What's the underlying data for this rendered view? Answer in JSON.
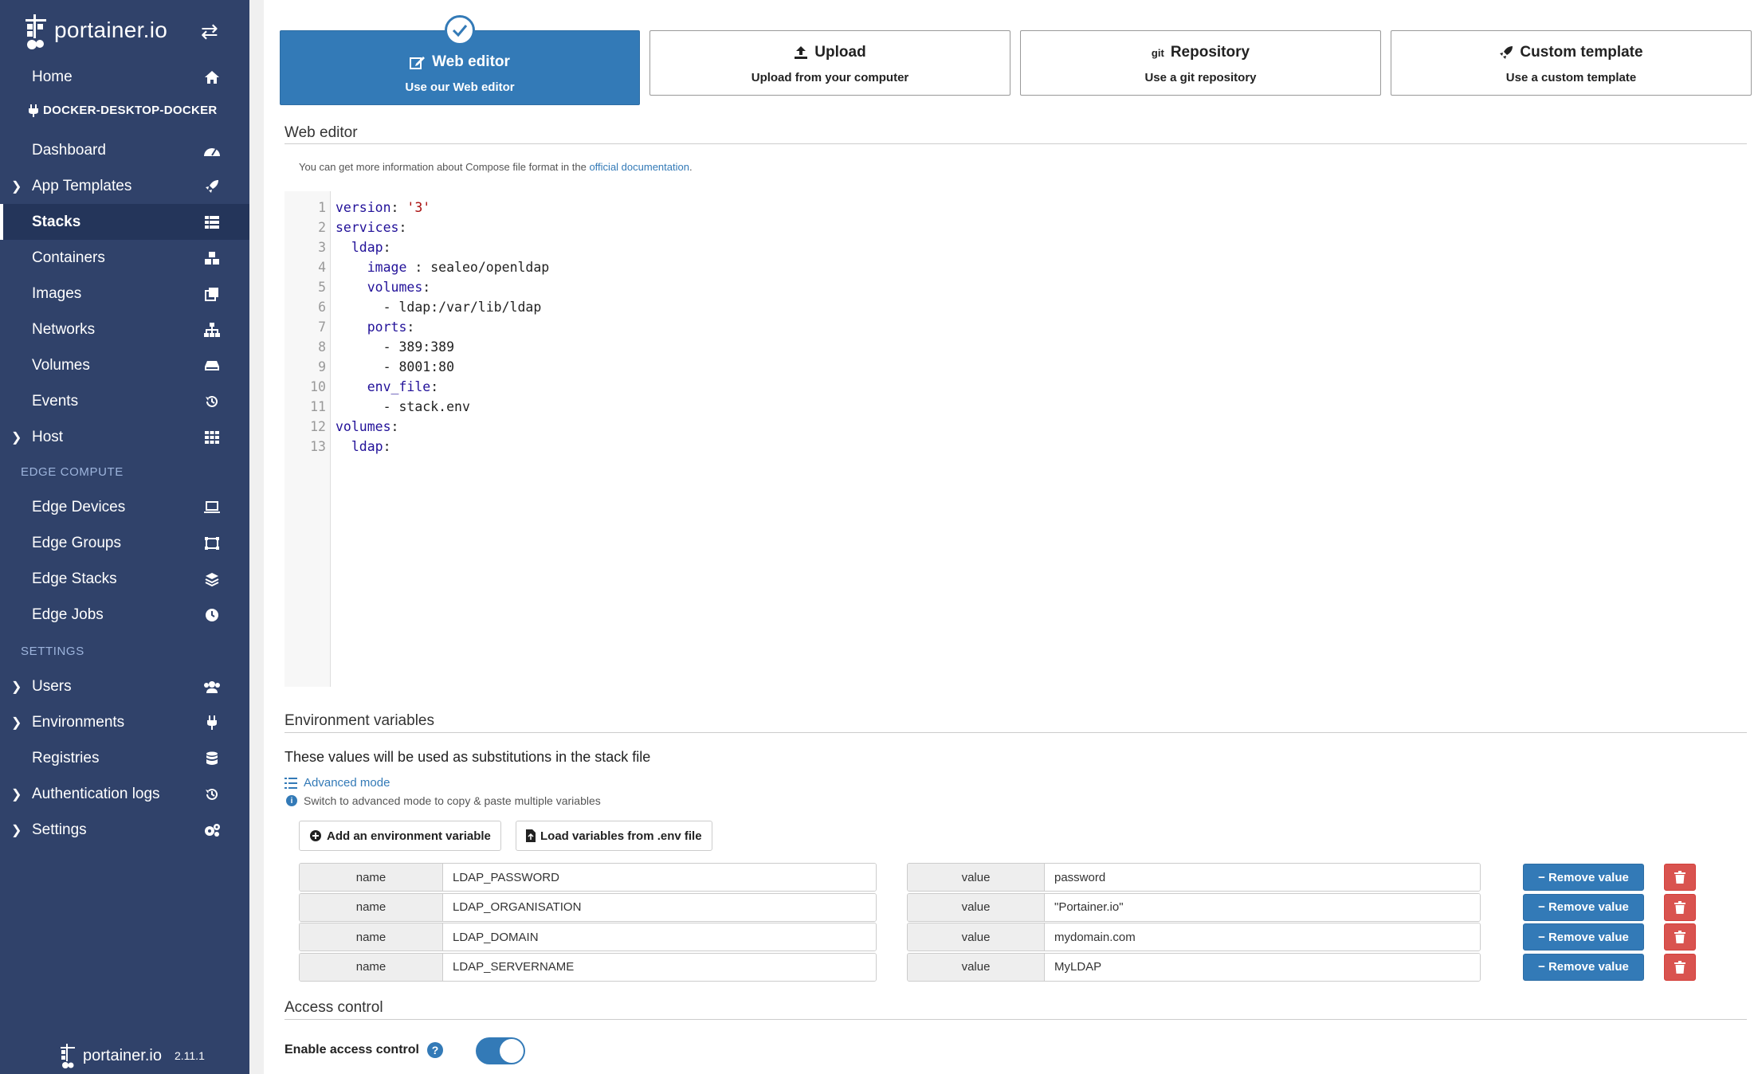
{
  "sidebar": {
    "brand": "portainer.io",
    "endpoint": "DOCKER-DESKTOP-DOCKER",
    "items": [
      {
        "label": "Home",
        "icon": "home-icon",
        "caret": false
      },
      {
        "label": "Dashboard",
        "icon": "tachometer-icon",
        "caret": false
      },
      {
        "label": "App Templates",
        "icon": "rocket-icon",
        "caret": true
      },
      {
        "label": "Stacks",
        "icon": "th-list-icon",
        "caret": false,
        "active": true
      },
      {
        "label": "Containers",
        "icon": "cubes-icon",
        "caret": false
      },
      {
        "label": "Images",
        "icon": "clone-icon",
        "caret": false
      },
      {
        "label": "Networks",
        "icon": "sitemap-icon",
        "caret": false
      },
      {
        "label": "Volumes",
        "icon": "hdd-icon",
        "caret": false
      },
      {
        "label": "Events",
        "icon": "history-icon",
        "caret": false
      },
      {
        "label": "Host",
        "icon": "th-icon",
        "caret": true
      },
      {
        "label": "Edge Devices",
        "icon": "laptop-icon",
        "caret": false
      },
      {
        "label": "Edge Groups",
        "icon": "object-group-icon",
        "caret": false
      },
      {
        "label": "Edge Stacks",
        "icon": "layer-group-icon",
        "caret": false
      },
      {
        "label": "Edge Jobs",
        "icon": "clock-icon",
        "caret": false
      },
      {
        "label": "Users",
        "icon": "users-icon",
        "caret": true
      },
      {
        "label": "Environments",
        "icon": "plug-icon",
        "caret": true
      },
      {
        "label": "Registries",
        "icon": "database-icon",
        "caret": false
      },
      {
        "label": "Authentication logs",
        "icon": "history-icon",
        "caret": true
      },
      {
        "label": "Settings",
        "icon": "cogs-icon",
        "caret": true
      }
    ],
    "sections": {
      "edge": "EDGE COMPUTE",
      "settings": "SETTINGS"
    },
    "footer": {
      "brand": "portainer.io",
      "version": "2.11.1"
    }
  },
  "methods": [
    {
      "title": "Web editor",
      "subtitle": "Use our Web editor",
      "icon": "edit-icon",
      "active": true
    },
    {
      "title": "Upload",
      "subtitle": "Upload from your computer",
      "icon": "upload-icon",
      "active": false
    },
    {
      "title": "Repository",
      "subtitle": "Use a git repository",
      "icon": "git-icon",
      "active": false
    },
    {
      "title": "Custom template",
      "subtitle": "Use a custom template",
      "icon": "rocket-icon",
      "active": false
    }
  ],
  "editor": {
    "section_title": "Web editor",
    "hint_prefix": "You can get more information about Compose file format in the ",
    "hint_link": "official documentation",
    "hint_suffix": ".",
    "lines": [
      "version: '3'",
      "services:",
      "  ldap:",
      "    image : sealeo/openldap",
      "    volumes:",
      "      - ldap:/var/lib/ldap",
      "    ports:",
      "      - 389:389",
      "      - 8001:80",
      "    env_file:",
      "      - stack.env",
      "volumes:",
      "  ldap:"
    ]
  },
  "env": {
    "section_title": "Environment variables",
    "description": "These values will be used as substitutions in the stack file",
    "advanced_mode": "Advanced mode",
    "advanced_hint": "Switch to advanced mode to copy & paste multiple variables",
    "add_button": "Add an environment variable",
    "load_button": "Load variables from .env file",
    "name_label": "name",
    "value_label": "value",
    "remove_label": "Remove value",
    "rows": [
      {
        "name": "LDAP_PASSWORD",
        "value": "password"
      },
      {
        "name": "LDAP_ORGANISATION",
        "value": "\"Portainer.io\""
      },
      {
        "name": "LDAP_DOMAIN",
        "value": "mydomain.com"
      },
      {
        "name": "LDAP_SERVERNAME",
        "value": "MyLDAP"
      }
    ]
  },
  "access": {
    "section_title": "Access control",
    "enable_label": "Enable access control",
    "enabled": true
  },
  "colors": {
    "sidebar": "#30426a",
    "primary": "#337ab7",
    "danger": "#d9534f"
  }
}
